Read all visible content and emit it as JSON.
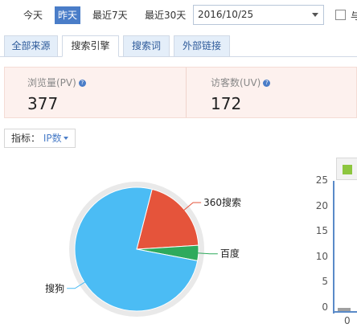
{
  "date_filter": {
    "today": "今天",
    "yesterday": "昨天",
    "last7": "最近7天",
    "last30": "最近30天",
    "date_value": "2016/10/25",
    "compare_label": "与"
  },
  "tabs": [
    {
      "label": "全部来源"
    },
    {
      "label": "搜索引擎"
    },
    {
      "label": "搜索词"
    },
    {
      "label": "外部链接"
    }
  ],
  "summary": {
    "pv_label": "浏览量(PV)",
    "pv_value": "377",
    "uv_label": "访客数(UV)",
    "uv_value": "172"
  },
  "indicator": {
    "label": "指标：",
    "value": "IP数"
  },
  "colors": {
    "accent": "#4a7dc8",
    "pie_sougou": "#4bbcf4",
    "pie_360": "#e5543b",
    "pie_baidu": "#2eaa5c",
    "bar_series": "#8dc63f"
  },
  "chart_data": [
    {
      "type": "pie",
      "title": "",
      "slices": [
        {
          "label": "搜狗",
          "value": 76
        },
        {
          "label": "360搜索",
          "value": 20
        },
        {
          "label": "百度",
          "value": 4
        }
      ]
    },
    {
      "type": "bar",
      "title": "",
      "categories": [
        "0"
      ],
      "values": [
        0
      ],
      "ylim": [
        0,
        25
      ],
      "yticks": [
        "25",
        "20",
        "15",
        "10",
        "5",
        "0"
      ]
    }
  ]
}
